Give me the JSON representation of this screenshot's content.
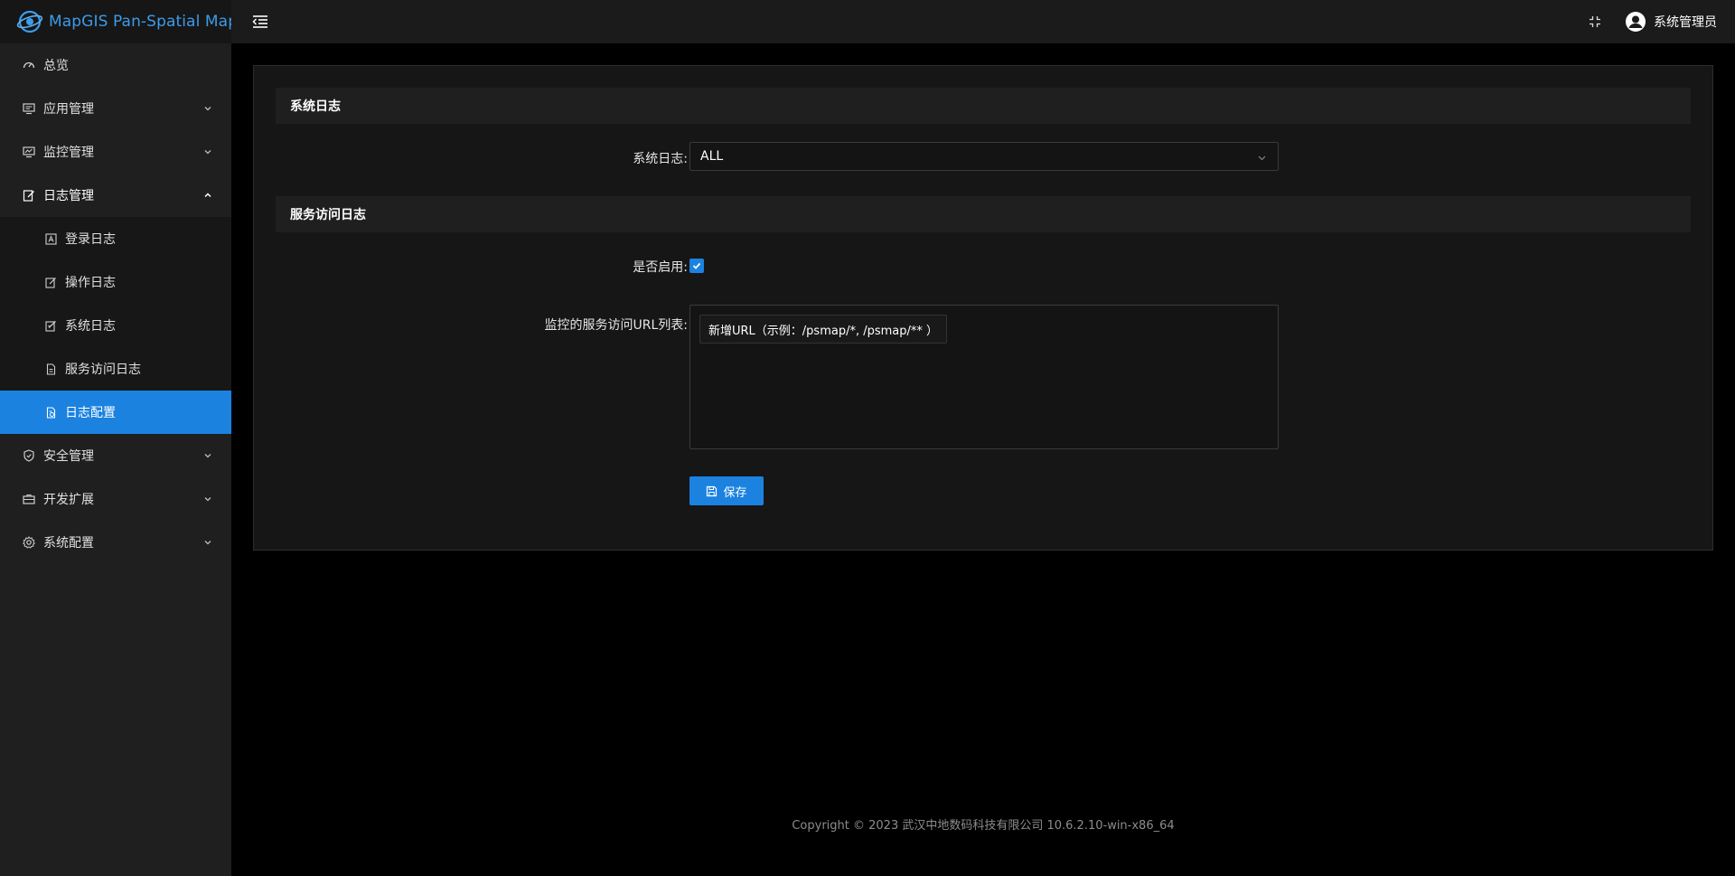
{
  "app": {
    "title": "MapGIS Pan-Spatial Map"
  },
  "header": {
    "username": "系统管理员"
  },
  "sidebar": {
    "items": [
      {
        "label": "总览",
        "icon": "dashboard-icon"
      },
      {
        "label": "应用管理",
        "icon": "monitor-icon"
      },
      {
        "label": "监控管理",
        "icon": "chart-monitor-icon"
      },
      {
        "label": "日志管理",
        "icon": "edit-log-icon",
        "expanded": true
      },
      {
        "label": "安全管理",
        "icon": "shield-icon"
      },
      {
        "label": "开发扩展",
        "icon": "toolbox-icon"
      },
      {
        "label": "系统配置",
        "icon": "gear-icon"
      }
    ],
    "log_submenu": [
      {
        "label": "登录日志",
        "icon": "login-log-icon"
      },
      {
        "label": "操作日志",
        "icon": "operation-log-icon"
      },
      {
        "label": "系统日志",
        "icon": "system-log-icon"
      },
      {
        "label": "服务访问日志",
        "icon": "file-log-icon"
      },
      {
        "label": "日志配置",
        "icon": "log-config-icon",
        "active": true
      }
    ]
  },
  "main": {
    "system_log_section": {
      "title": "系统日志",
      "field_label": "系统日志:",
      "value": "ALL"
    },
    "service_log_section": {
      "title": "服务访问日志",
      "enabled_label": "是否启用:",
      "enabled": true,
      "url_list_label": "监控的服务访问URL列表:",
      "add_url_tag": "新增URL（示例：/psmap/*, /psmap/** ）"
    },
    "save_label": "保存"
  },
  "footer": {
    "text": "Copyright © 2023 武汉中地数码科技有限公司 10.6.2.10-win-x86_64"
  },
  "colors": {
    "accent": "#1b82e0",
    "logo": "#3d9be9"
  }
}
